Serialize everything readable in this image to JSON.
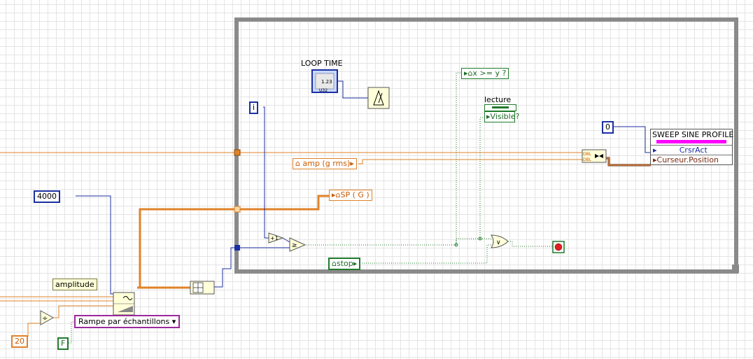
{
  "loop_time": {
    "label": "LOOP TIME",
    "indicator_text": "1.23",
    "type_tag": "U32"
  },
  "constants": {
    "count": "4000",
    "index": "i",
    "zero": "0",
    "divisor": "20",
    "false_const": "F"
  },
  "locals": {
    "compare": "x >= y ?",
    "amp": "amp (g rms)",
    "sp": "SP ( G )",
    "stop": "stop"
  },
  "lecture_node": {
    "label": "lecture",
    "row": "Visible?"
  },
  "sweep_node": {
    "title": "SWEEP SINE PROFILE",
    "row1": "CrsrAct",
    "row2": "Curseur.Position"
  },
  "amplitude_label": "amplitude",
  "ramp_ring": {
    "value": "Rampe par échantillons"
  },
  "bundle_tags": [
    "DBL",
    "DBL"
  ],
  "colors": {
    "orange_wire": "#e0832a",
    "blue_wire": "#1c2fa3",
    "green_wire": "#1f7a2a",
    "loop_border": "#8a8a8a"
  }
}
